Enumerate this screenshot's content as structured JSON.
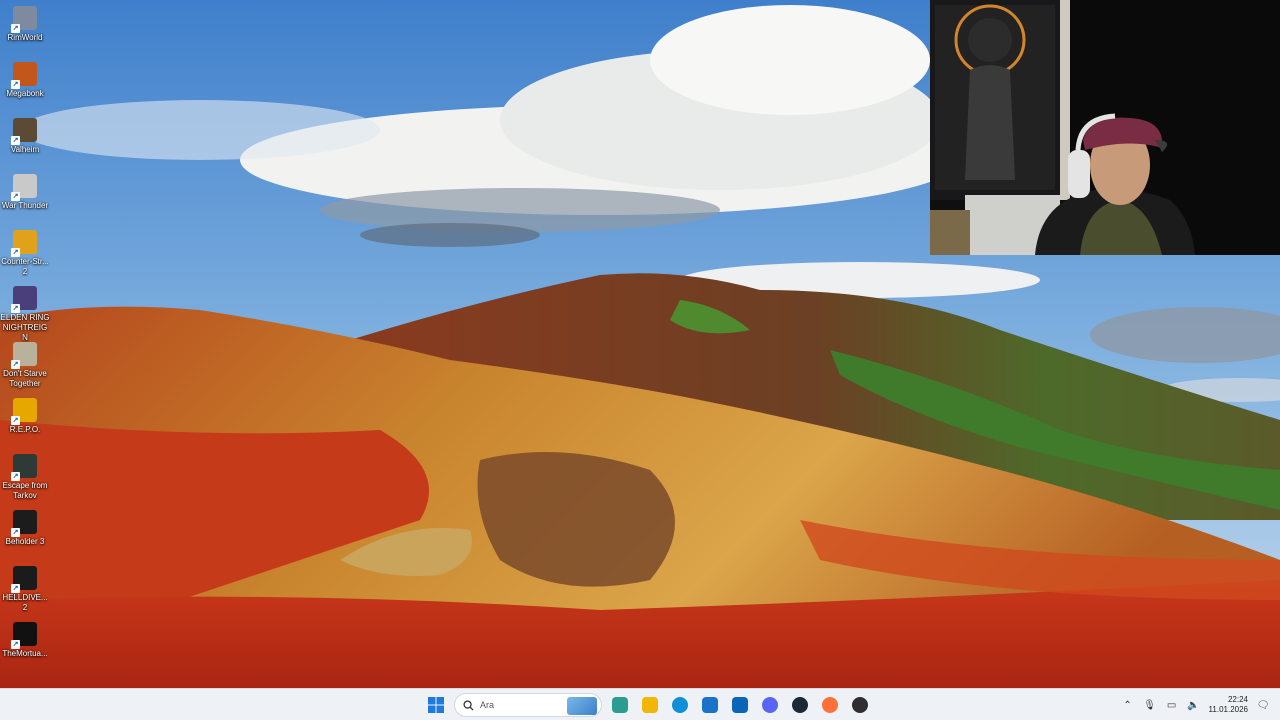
{
  "desktop_icons": [
    {
      "label": "RimWorld",
      "icon": "rimworld-icon",
      "color": "#7d8aa0"
    },
    {
      "label": "Megabonk",
      "icon": "megabonk-icon",
      "color": "#c2561b"
    },
    {
      "label": "Valheim",
      "icon": "valheim-icon",
      "color": "#5b4a36"
    },
    {
      "label": "War Thunder",
      "icon": "war-thunder-icon",
      "color": "#c9c9c9"
    },
    {
      "label": "Counter-Str... 2",
      "icon": "counter-strike-icon",
      "color": "#e0a21a"
    },
    {
      "label": "ELDEN RING NIGHTREIGN",
      "icon": "elden-ring-icon",
      "color": "#4a3f7a"
    },
    {
      "label": "Don't Starve Together",
      "icon": "dont-starve-icon",
      "color": "#b9b19a"
    },
    {
      "label": "R.E.P.O.",
      "icon": "repo-icon",
      "color": "#e6a700"
    },
    {
      "label": "Escape from Tarkov",
      "icon": "tarkov-icon",
      "color": "#2f3a36"
    },
    {
      "label": "Beholder 3",
      "icon": "beholder-icon",
      "color": "#1c1c1c"
    },
    {
      "label": "HELLDIVE... 2",
      "icon": "helldivers-icon",
      "color": "#1b1b1b"
    },
    {
      "label": "TheMortua...",
      "icon": "mortuary-icon",
      "color": "#111111"
    }
  ],
  "taskbar": {
    "search_placeholder": "Ara",
    "apps": [
      {
        "name": "start-button",
        "icon": "windows-icon",
        "color": "#1f7ae0"
      },
      {
        "name": "widgets-button",
        "icon": "widgets-icon",
        "color": "#2a9d8f"
      },
      {
        "name": "file-explorer-button",
        "icon": "folder-icon",
        "color": "#f2b705"
      },
      {
        "name": "edge-button",
        "icon": "edge-icon",
        "color": "#0f8fd8"
      },
      {
        "name": "store-button",
        "icon": "store-icon",
        "color": "#1a73c9"
      },
      {
        "name": "outlook-button",
        "icon": "outlook-icon",
        "color": "#0a64b8"
      },
      {
        "name": "discord-button",
        "icon": "discord-icon",
        "color": "#5865f2"
      },
      {
        "name": "steam-button",
        "icon": "steam-icon",
        "color": "#1b2838"
      },
      {
        "name": "firefox-button",
        "icon": "firefox-icon",
        "color": "#ff7139"
      },
      {
        "name": "obs-button",
        "icon": "obs-icon",
        "color": "#302e31"
      }
    ],
    "time": "22:24",
    "date": "11.01.2026"
  },
  "colors": {
    "sky": "#5d95d2",
    "red_ground": "#c23a16",
    "ochre": "#c98a2b",
    "green_moss": "#4f7a2c",
    "taskbar_bg": "#eef1f6"
  }
}
